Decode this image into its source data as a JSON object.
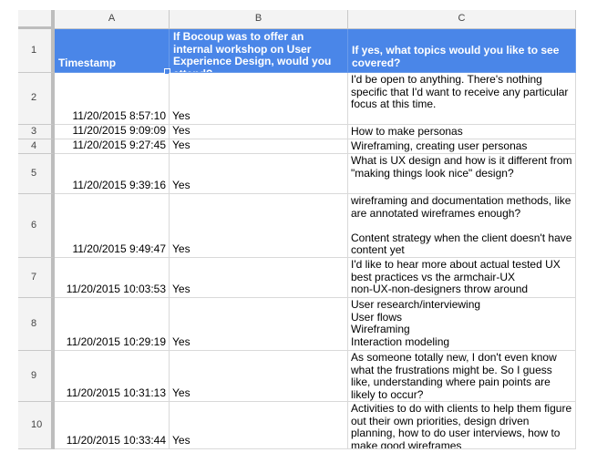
{
  "columns": [
    "A",
    "B",
    "C"
  ],
  "header": {
    "row_number": "1",
    "timestamp": "Timestamp",
    "attend": "If Bocoup was to offer an internal workshop on User Experience Design, would you attend?",
    "topics": "If yes, what topics would you like to see covered?"
  },
  "rows": [
    {
      "num": "2",
      "timestamp": "11/20/2015 8:57:10",
      "attend": "Yes",
      "topics": "I'd be open to anything. There's nothing specific that I'd want to receive any particular focus at this time."
    },
    {
      "num": "3",
      "timestamp": "11/20/2015 9:09:09",
      "attend": "Yes",
      "topics": "How to make personas"
    },
    {
      "num": "4",
      "timestamp": "11/20/2015 9:27:45",
      "attend": "Yes",
      "topics": "Wireframing, creating user personas"
    },
    {
      "num": "5",
      "timestamp": "11/20/2015 9:39:16",
      "attend": "Yes",
      "topics": "What is UX design and how is it different from \"making things look nice\" design?"
    },
    {
      "num": "6",
      "timestamp": "11/20/2015 9:49:47",
      "attend": "Yes",
      "topics": "wireframing and documentation methods, like are annotated wireframes enough?\n\nContent strategy when the client doesn't have content yet"
    },
    {
      "num": "7",
      "timestamp": "11/20/2015 10:03:53",
      "attend": "Yes",
      "topics": "I'd like to hear more about actual tested UX best practices vs the armchair-UX\nnon-UX-non-designers throw around casually!"
    },
    {
      "num": "8",
      "timestamp": "11/20/2015 10:29:19",
      "attend": "Yes",
      "topics": "User research/interviewing\nUser flows\nWireframing\nInteraction modeling"
    },
    {
      "num": "9",
      "timestamp": "11/20/2015 10:31:13",
      "attend": "Yes",
      "topics": "As someone totally new, I don't even know what the frustrations might be. So I guess like, understanding where pain points are likely to occur?"
    },
    {
      "num": "10",
      "timestamp": "11/20/2015 10:33:44",
      "attend": "Yes",
      "topics": "Activities to do with clients to help them figure out their own priorities, design driven planning, how to do user interviews, how to make good wireframes"
    }
  ]
}
